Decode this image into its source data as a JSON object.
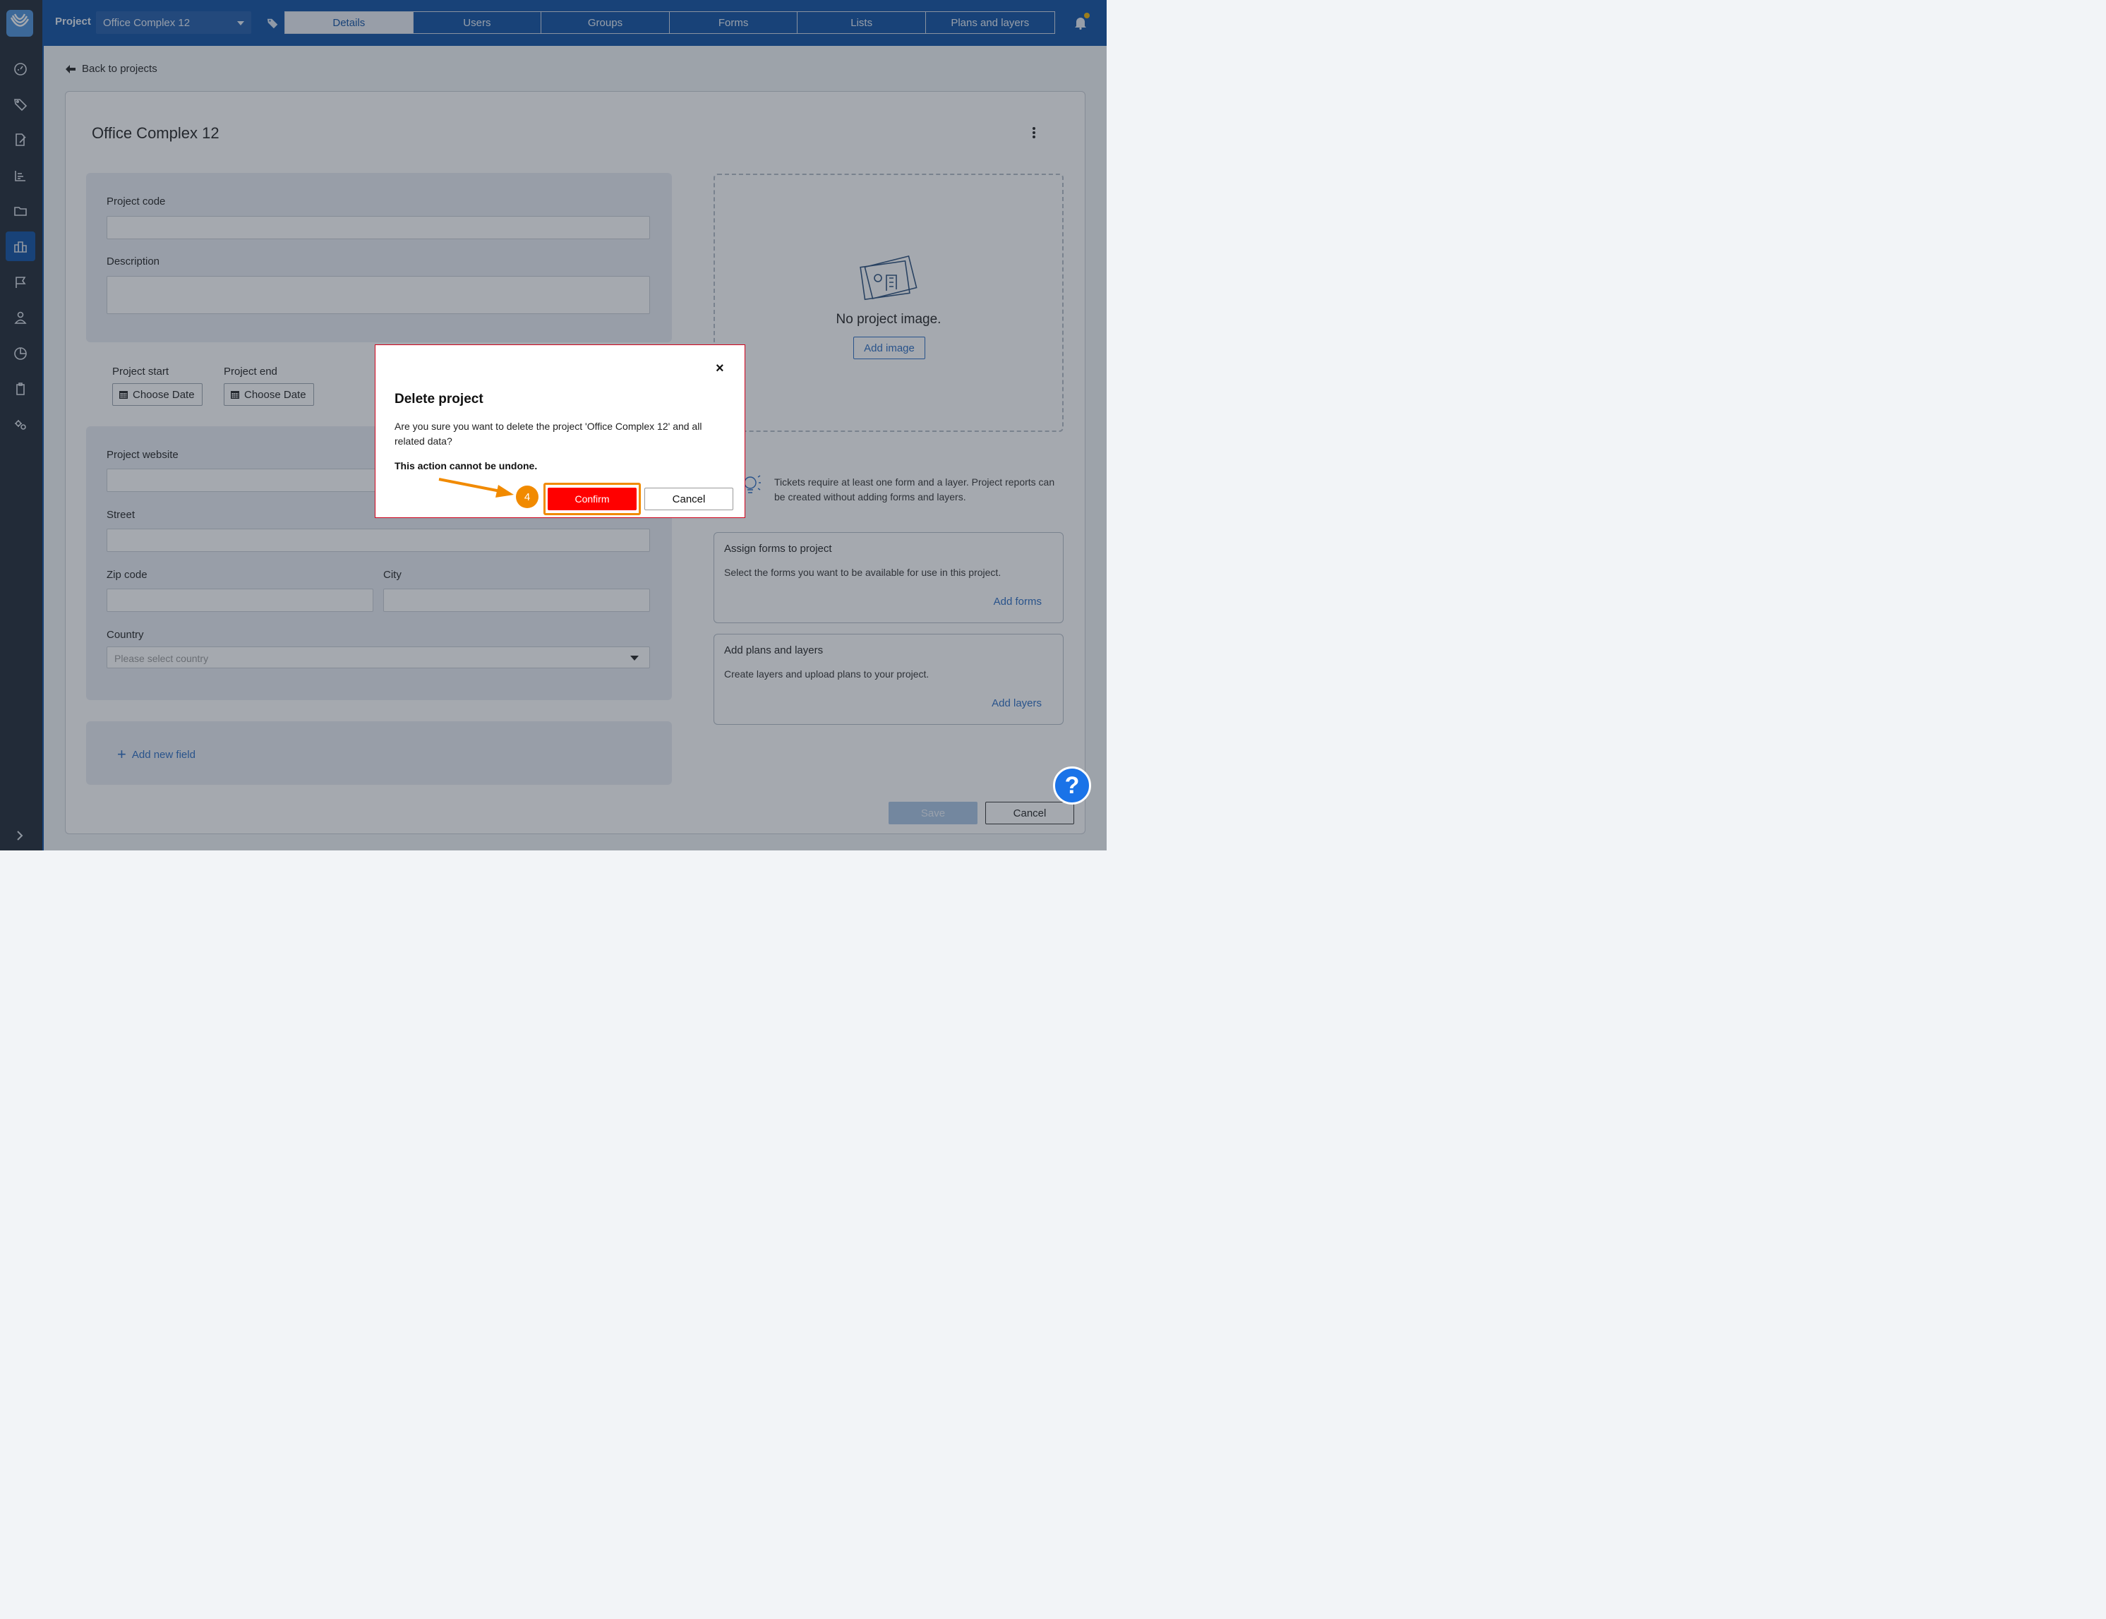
{
  "topbar": {
    "project_label": "Project",
    "project_selected": "Office Complex 12",
    "tabs": [
      "Details",
      "Users",
      "Groups",
      "Forms",
      "Lists",
      "Plans and layers"
    ],
    "active_tab": "Details"
  },
  "sidebar": {
    "icons": [
      "dashboard-icon",
      "tag-icon",
      "edit-document-icon",
      "chart-icon",
      "folder-icon",
      "buildings-icon",
      "flag-icon",
      "user-icon",
      "pie-chart-icon",
      "clipboard-icon",
      "settings-icon"
    ],
    "active_index": 5
  },
  "main": {
    "back_label": "Back to projects",
    "title": "Office Complex 12",
    "fields": {
      "project_code": "Project code",
      "description": "Description",
      "project_start": "Project start",
      "project_end": "Project end",
      "choose_date": "Choose Date",
      "project_website": "Project website",
      "street": "Street",
      "zip_code": "Zip code",
      "city": "City",
      "country": "Country",
      "country_placeholder": "Please select country"
    },
    "add_new_field": "Add new field",
    "image": {
      "empty_text": "No project image.",
      "add_button": "Add image"
    },
    "hint": "Tickets require at least one form and a layer. Project reports can be created without adding forms and layers.",
    "assign_forms": {
      "title": "Assign forms to project",
      "text": "Select the forms you want to be available for use in this project.",
      "link": "Add forms"
    },
    "add_plans": {
      "title": "Add plans and layers",
      "text": "Create layers and upload plans to your project.",
      "link": "Add layers"
    },
    "save": "Save",
    "cancel": "Cancel"
  },
  "modal": {
    "close": "×",
    "title": "Delete project",
    "text": "Are you sure you want to delete the project 'Office Complex 12' and all related data?",
    "warning": "This action cannot be undone.",
    "confirm": "Confirm",
    "cancel": "Cancel",
    "step": "4"
  },
  "help": "?",
  "colors": {
    "brand_blue": "#0d4fa0",
    "danger_red": "#ff0000",
    "highlight_orange": "#f18a00",
    "link_blue": "#2a6cc2"
  }
}
